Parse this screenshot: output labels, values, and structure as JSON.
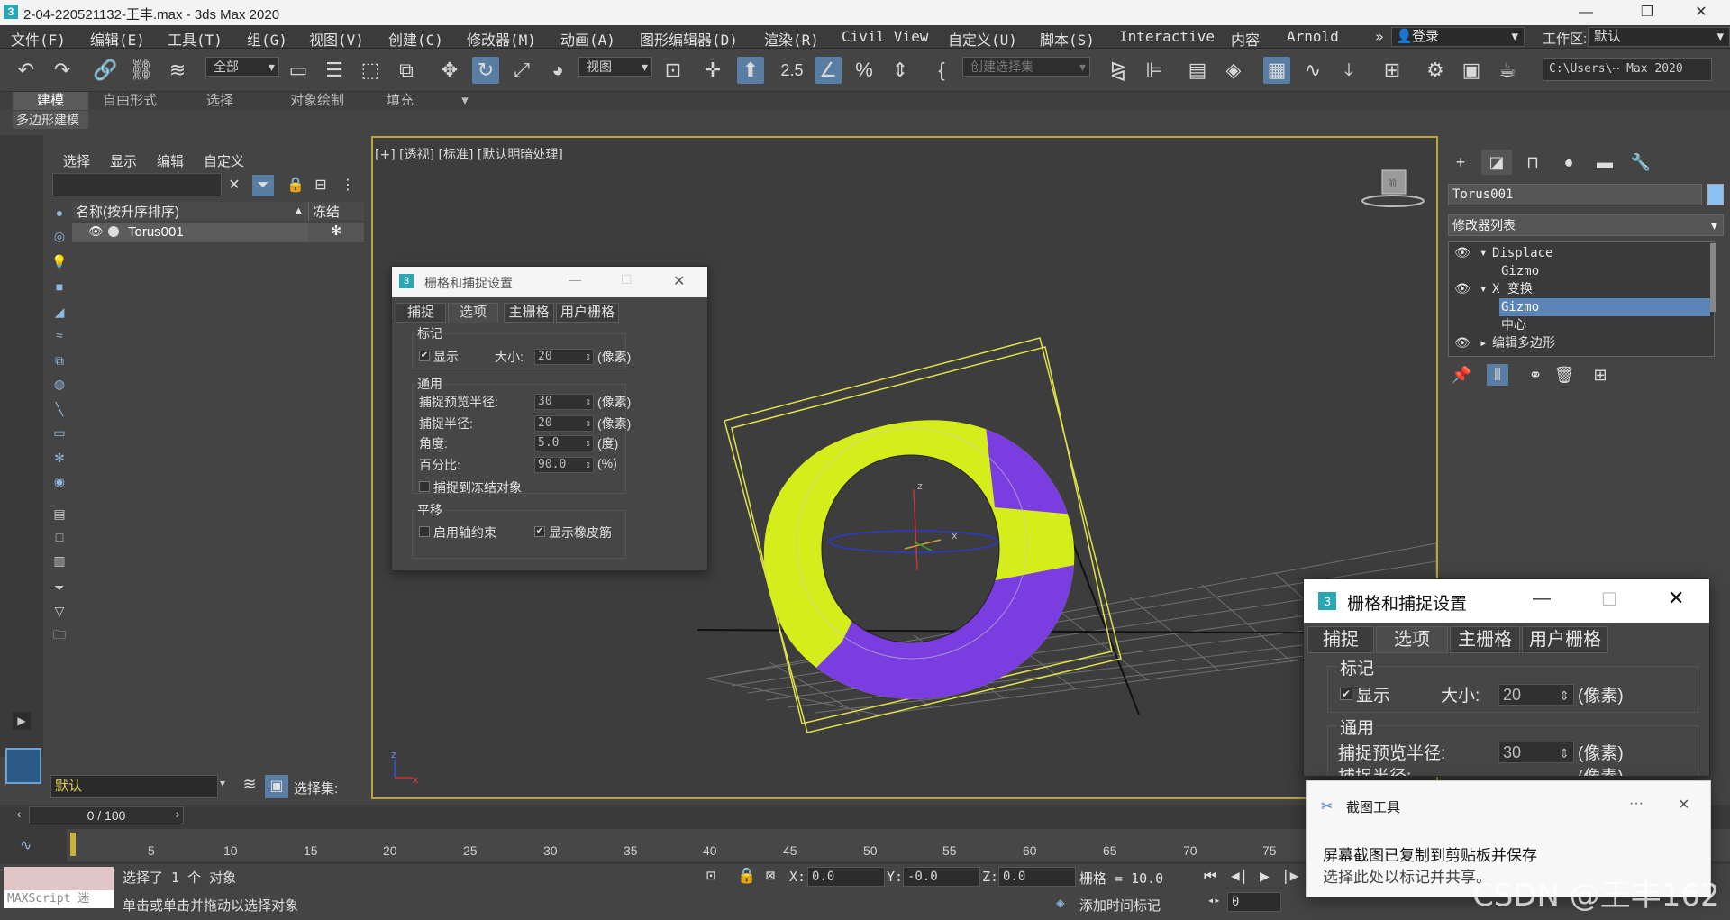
{
  "titlebar": {
    "title": "2-04-220521132-王丰.max - 3ds Max 2020",
    "app_icon": "3",
    "min": "—",
    "restore": "❐",
    "close": "✕"
  },
  "menu": [
    "文件(F)",
    "编辑(E)",
    "工具(T)",
    "组(G)",
    "视图(V)",
    "创建(C)",
    "修改器(M)",
    "动画(A)",
    "图形编辑器(D)",
    "渲染(R)",
    "Civil View",
    "自定义(U)",
    "脚本(S)",
    "Interactive",
    "内容",
    "Arnold"
  ],
  "menu_overflow": "»",
  "login": {
    "label": "登录",
    "arrow": "▾"
  },
  "workspace": {
    "label": "工作区:",
    "value": "默认",
    "arrow": "▾"
  },
  "toolbar": {
    "selection_filter": "全部",
    "reference_coord": "视图",
    "named_selection": "创建选择集",
    "project_path": "C:\\Users\\⋯ Max 2020",
    "snap_label": "2.5"
  },
  "ribbon": {
    "tabs": [
      "建模",
      "自由形式",
      "选择",
      "对象绘制",
      "填充"
    ],
    "sub": "多边形建模",
    "extra_icon": "▾"
  },
  "explorer": {
    "menus": [
      "选择",
      "显示",
      "编辑",
      "自定义"
    ],
    "col_name": "名称(按升序排序)",
    "col_sort": "▲",
    "col_freeze": "冻结",
    "row_name": "Torus001",
    "row_freeze": "✻",
    "layer": "默认",
    "selection_set_label": "选择集:"
  },
  "viewport": {
    "label": "[+] [透视] [标准] [默认明暗处理]",
    "cube_label": "前",
    "axis": {
      "x": "x",
      "y": "y",
      "z": "z"
    },
    "colors": {
      "yellow": "#d6ed1c",
      "purple": "#7a3ee0",
      "gizmo": "#e0e04a"
    }
  },
  "command_panel": {
    "object_name": "Torus001",
    "modifier_list": "修改器列表",
    "stack": [
      {
        "label": "Displace",
        "eye": true,
        "expand": "▾"
      },
      {
        "label": "Gizmo",
        "eye": false,
        "expand": ""
      },
      {
        "label": "X 变换",
        "eye": true,
        "expand": "▾"
      },
      {
        "label": "Gizmo",
        "eye": false,
        "expand": "",
        "selected": true
      },
      {
        "label": "中心",
        "eye": false,
        "expand": ""
      },
      {
        "label": "编辑多边形",
        "eye": true,
        "expand": "▸"
      }
    ]
  },
  "dialog_small": {
    "title": "栅格和捕捉设置",
    "tabs": [
      "捕捉",
      "选项",
      "主栅格",
      "用户栅格"
    ],
    "active_tab": 1,
    "marker_group": "标记",
    "show_label": "显示",
    "show_checked": true,
    "size_label": "大小:",
    "size_value": "20",
    "size_unit": "(像素)",
    "general_group": "通用",
    "preview_radius_label": "捕捉预览半径:",
    "preview_radius_value": "30",
    "preview_radius_unit": "(像素)",
    "snap_radius_label": "捕捉半径:",
    "snap_radius_value": "20",
    "snap_radius_unit": "(像素)",
    "angle_label": "角度:",
    "angle_value": "5.0",
    "angle_unit": "(度)",
    "percent_label": "百分比:",
    "percent_value": "90.0",
    "percent_unit": "(%)",
    "snap_frozen_label": "捕捉到冻结对象",
    "snap_frozen_checked": false,
    "translation_group": "平移",
    "axis_constraint_label": "启用轴约束",
    "axis_constraint_checked": false,
    "rubber_band_label": "显示橡皮筋",
    "rubber_band_checked": true
  },
  "dialog_big": {
    "title": "栅格和捕捉设置",
    "tabs": [
      "捕捉",
      "选项",
      "主栅格",
      "用户栅格"
    ],
    "marker_group": "标记",
    "show_label": "显示",
    "size_label": "大小:",
    "size_value": "20",
    "size_unit": "(像素)",
    "general_group": "通用",
    "preview_radius_label": "捕捉预览半径:",
    "preview_radius_value": "30",
    "preview_radius_unit": "(像素)",
    "snap_radius_label": "捕捉半径:",
    "snap_radius_unit": "(像素)"
  },
  "timeline": {
    "slider": "0 / 100",
    "ticks": [
      "5",
      "10",
      "15",
      "20",
      "25",
      "30",
      "35",
      "40",
      "45",
      "50",
      "55",
      "60",
      "65",
      "70",
      "75"
    ]
  },
  "status": {
    "maxscript": "MAXScript 迷",
    "selected": "选择了 1 个 对象",
    "prompt": "单击或单击并拖动以选择对象",
    "x_label": "X:",
    "x_value": "0.0",
    "y_label": "Y:",
    "y_value": "-0.0",
    "z_label": "Z:",
    "z_value": "0.0",
    "grid": "栅格 = 10.0",
    "add_time_tag": "添加时间标记",
    "frame_value": "0"
  },
  "toast": {
    "app": "截图工具",
    "more": "···",
    "close": "✕",
    "line1": "屏幕截图已复制到剪贴板并保存",
    "line2": "选择此处以标记并共享。"
  },
  "watermark": "CSDN @王丰162"
}
